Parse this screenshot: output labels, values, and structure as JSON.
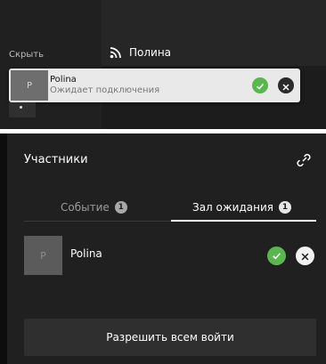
{
  "top": {
    "hide_label": "Скрыть",
    "speaker_name": "Полина"
  },
  "toast": {
    "avatar_letter": "P",
    "name": "Polina",
    "status": "Ожидает подключения"
  },
  "panel": {
    "title": "Участники",
    "tabs": [
      {
        "label": "Событие",
        "count": "1"
      },
      {
        "label": "Зал ожидания",
        "count": "1"
      }
    ],
    "active_tab": "Зал ожидания",
    "participants": [
      {
        "avatar_letter": "P",
        "name": "Polina"
      }
    ],
    "admit_all_label": "Разрешить всем войти"
  },
  "colors": {
    "approve": "#58b84d",
    "panel_bg": "#202020",
    "button_bg": "#2f2f2f"
  },
  "icons": [
    "rss-icon",
    "check-icon",
    "close-icon",
    "link-icon"
  ]
}
